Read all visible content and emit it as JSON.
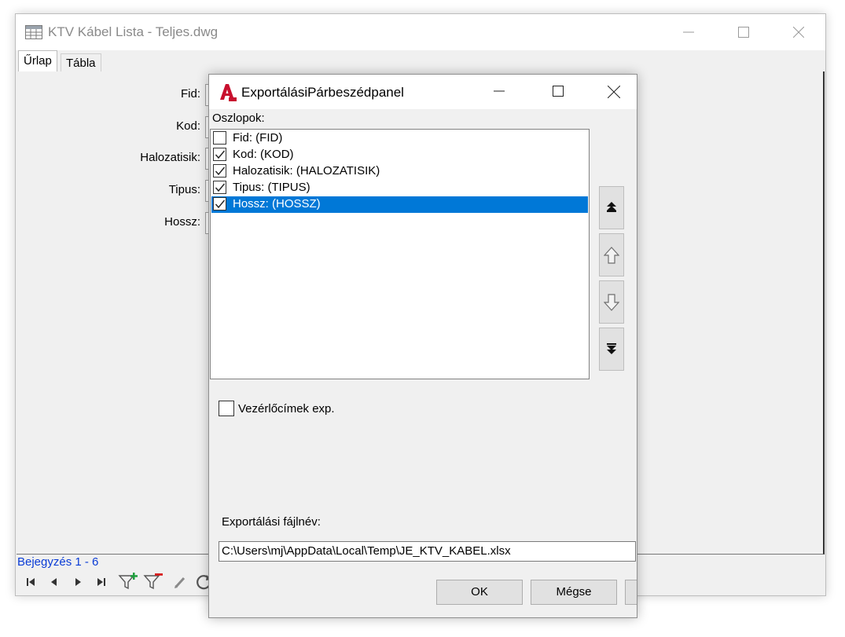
{
  "main_window": {
    "title": "KTV Kábel Lista - Teljes.dwg",
    "tabs": [
      {
        "label": "Űrlap",
        "active": true
      },
      {
        "label": "Tábla",
        "active": false
      }
    ],
    "form_fields": [
      {
        "label": "Fid:"
      },
      {
        "label": "Kod:"
      },
      {
        "label": "Halozatisik:"
      },
      {
        "label": "Tipus:"
      },
      {
        "label": "Hossz:"
      }
    ],
    "record_status": "Bejegyzés 1 - 6",
    "toolbar_icons": [
      "first-record-icon",
      "prev-record-icon",
      "next-record-icon",
      "last-record-icon",
      "add-filter-icon",
      "remove-filter-icon",
      "edit-icon",
      "refresh-icon"
    ]
  },
  "dialog": {
    "title": "ExportálásiPárbeszédpanel",
    "columns_label": "Oszlopok:",
    "columns": [
      {
        "label": "Fid: (FID)",
        "checked": false,
        "selected": false
      },
      {
        "label": "Kod: (KOD)",
        "checked": true,
        "selected": false
      },
      {
        "label": "Halozatisik: (HALOZATISIK)",
        "checked": true,
        "selected": false
      },
      {
        "label": "Tipus: (TIPUS)",
        "checked": true,
        "selected": false
      },
      {
        "label": "Hossz: (HOSSZ)",
        "checked": true,
        "selected": true
      }
    ],
    "move_buttons": [
      "move-top-icon",
      "move-up-icon",
      "move-down-icon",
      "move-bottom-icon"
    ],
    "export_labels": {
      "label": "Vezérlőcímek exp.",
      "checked": false
    },
    "filename_label": "Exportálási fájlnév:",
    "filename_value": "C:\\Users\\mj\\AppData\\Local\\Temp\\JE_KTV_KABEL.xlsx",
    "ok_label": "OK",
    "cancel_label": "Mégse"
  },
  "colors": {
    "selection": "#0078d7",
    "record_status": "#0a3cd6",
    "autocad_red": "#c8102e"
  }
}
